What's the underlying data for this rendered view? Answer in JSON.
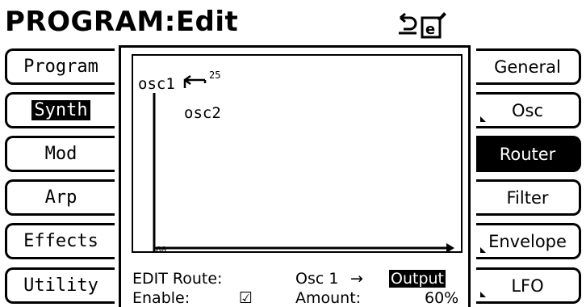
{
  "header": {
    "title": "PROGRAM:Edit",
    "icons": [
      "undo-icon",
      "edit-document-icon"
    ]
  },
  "left_tabs": [
    {
      "label": "Program",
      "active": false
    },
    {
      "label": "Synth",
      "active": true
    },
    {
      "label": "Mod",
      "active": false
    },
    {
      "label": "Arp",
      "active": false
    },
    {
      "label": "Effects",
      "active": false
    },
    {
      "label": "Utility",
      "active": false
    }
  ],
  "right_tabs": [
    {
      "label": "General",
      "active": false
    },
    {
      "label": "Osc",
      "active": false
    },
    {
      "label": "Router",
      "active": true
    },
    {
      "label": "Filter",
      "active": false
    },
    {
      "label": "Envelope",
      "active": false
    },
    {
      "label": "LFO",
      "active": false
    }
  ],
  "router": {
    "node1": "osc1",
    "node2": "osc2",
    "amount_marker": "25",
    "bottom_marker": "60"
  },
  "status": {
    "edit_label": "EDIT Route:",
    "route_source": "Osc 1",
    "route_arrow": "→",
    "route_dest": "Output",
    "enable_label": "Enable:",
    "enable_checked": "☑",
    "amount_label": "Amount:",
    "amount_value": "60%"
  }
}
